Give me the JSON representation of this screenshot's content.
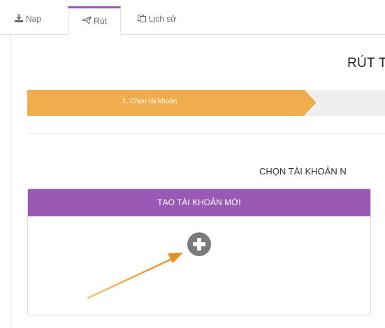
{
  "tabs": {
    "nap": "Nạp",
    "rut": "Rút",
    "lichsu": "Lịch sử"
  },
  "page": {
    "title": "RÚT T",
    "subtitle": "CHỌN TÀI KHOẢN N"
  },
  "steps": {
    "active_label": "1. Chọn tài khoản",
    "progress_active_index": 1
  },
  "card": {
    "header": "TẠO TÀI KHOẢN MỚI"
  },
  "colors": {
    "accent": "#9b59b6",
    "step_active": "#f0ad4e",
    "annotation_arrow": "#f0a030",
    "plus_icon": "#7a7a7a"
  },
  "icons": {
    "nap": "download-icon",
    "rut": "paper-plane-icon",
    "lichsu": "history-icon",
    "add": "plus-circle-icon"
  }
}
